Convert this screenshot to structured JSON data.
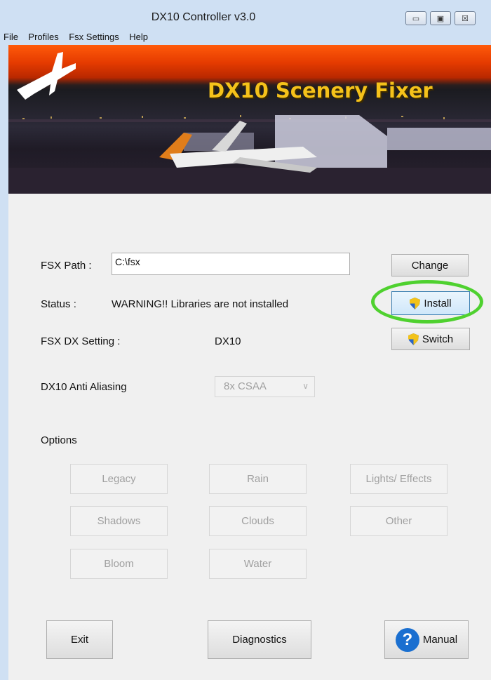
{
  "window": {
    "title": "DX10 Controller v3.0",
    "buttons": {
      "minimize": "▭",
      "maximize": "▣",
      "close": "☒"
    }
  },
  "menu": [
    "File",
    "Profiles",
    "Fsx Settings",
    "Help"
  ],
  "banner": {
    "title": "DX10 Scenery Fixer"
  },
  "fsx_path": {
    "label": "FSX Path :",
    "value": "C:\\fsx",
    "button": "Change"
  },
  "status": {
    "label": "Status :",
    "value": "WARNING!! Libraries are not installed",
    "button": "Install"
  },
  "dx_setting": {
    "label": "FSX DX Setting :",
    "value": "DX10",
    "button": "Switch"
  },
  "anti_aliasing": {
    "label": "DX10 Anti Aliasing",
    "selected": "8x CSAA"
  },
  "options": {
    "label": "Options",
    "buttons": [
      "Legacy",
      "Rain",
      "Lights/ Effects",
      "Shadows",
      "Clouds",
      "Other",
      "Bloom",
      "Water"
    ]
  },
  "footer": {
    "exit": "Exit",
    "diagnostics": "Diagnostics",
    "manual": "Manual"
  },
  "colors": {
    "highlight": "#4fd12f",
    "banner_title": "#f5c21a",
    "help_icon": "#1a6fd0"
  }
}
